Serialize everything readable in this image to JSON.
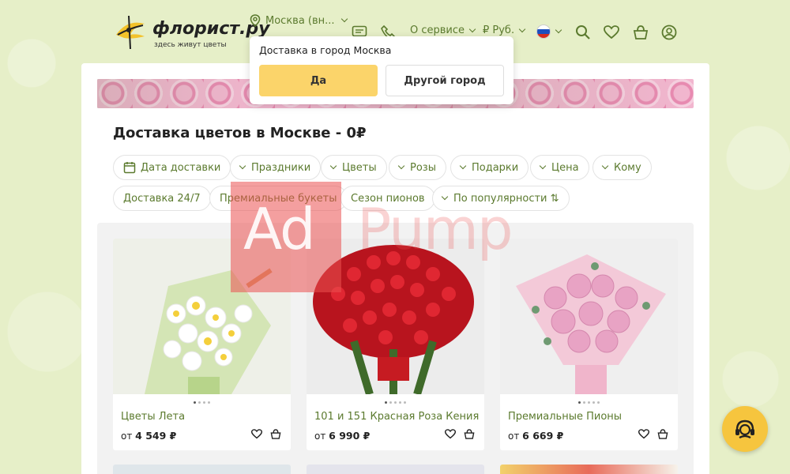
{
  "header": {
    "logo_text": "флорист.ру",
    "logo_sub": "здесь живут цветы",
    "city": "Москва (вн...",
    "service_menu": "О сервисе",
    "currency": "₽ Руб."
  },
  "city_popup": {
    "question": "Доставка в город Москва",
    "yes_label": "Да",
    "other_label": "Другой город"
  },
  "main": {
    "title": "Доставка цветов в Москве - 0₽"
  },
  "filters": [
    {
      "label": "Дата доставки"
    },
    {
      "label": "Праздники"
    },
    {
      "label": "Цветы"
    },
    {
      "label": "Розы"
    },
    {
      "label": "Подарки"
    },
    {
      "label": "Цена"
    },
    {
      "label": "Кому"
    },
    {
      "label": "Доставка 24/7"
    },
    {
      "label": "Премиальные букеты"
    },
    {
      "label": "Сезон пионов"
    },
    {
      "label": "По популярности ⇅"
    }
  ],
  "products": [
    {
      "name": "Цветы Лета",
      "price_prefix": "от",
      "price": "4 549 ₽"
    },
    {
      "name": "101 и 151 Красная Роза Кения",
      "price_prefix": "от",
      "price": "6 990 ₽"
    },
    {
      "name": "Премиальные Пионы",
      "price_prefix": "от",
      "price": "6 669 ₽"
    }
  ],
  "watermark": {
    "text_a": "Ad",
    "text_b": "Pump"
  },
  "colors": {
    "accent_green": "#5b7a2e",
    "yes_button": "#fbd46a",
    "chat_button": "#f6c53e",
    "page_bg": "#e6efc8"
  }
}
